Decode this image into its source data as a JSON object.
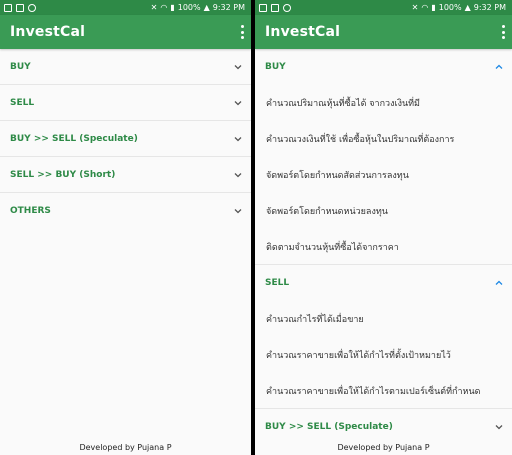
{
  "status_bar": {
    "battery": "100%",
    "time": "9:32 PM"
  },
  "app": {
    "title": "InvestCal"
  },
  "left_screen": {
    "sections": [
      {
        "label": "BUY"
      },
      {
        "label": "SELL"
      },
      {
        "label": "BUY >> SELL (Speculate)"
      },
      {
        "label": "SELL >> BUY (Short)"
      },
      {
        "label": "OTHERS"
      }
    ]
  },
  "right_screen": {
    "buy_section": {
      "label": "BUY",
      "items": [
        "คำนวณปริมาณหุ้นที่ซื้อได้ จากวงเงินที่มี",
        "คำนวณวงเงินที่ใช้ เพื่อซื้อหุ้นในปริมาณที่ต้องการ",
        "จัดพอร์ตโดยกำหนดสัดส่วนการลงทุน",
        "จัดพอร์ตโดยกำหนดหน่วยลงทุน",
        "ติดตามจำนวนหุ้นที่ซื้อได้จากราคา"
      ]
    },
    "sell_section": {
      "label": "SELL",
      "items": [
        "คำนวณกำไรที่ได้เมื่อขาย",
        "คำนวณราคาขายเพื่อให้ได้กำไรที่ตั้งเป้าหมายไว้",
        "คำนวณราคาขายเพื่อให้ได้กำไรตามเปอร์เซ็นต์ที่กำหนด"
      ]
    },
    "speculate_section": {
      "label": "BUY >> SELL (Speculate)"
    }
  },
  "footer": {
    "text": "Developed by Pujana P"
  },
  "colors": {
    "status_bar": "#2e8a47",
    "app_bar": "#3a9b55",
    "accent": "#2e8a47",
    "expanded_chevron": "#1e88e5"
  }
}
